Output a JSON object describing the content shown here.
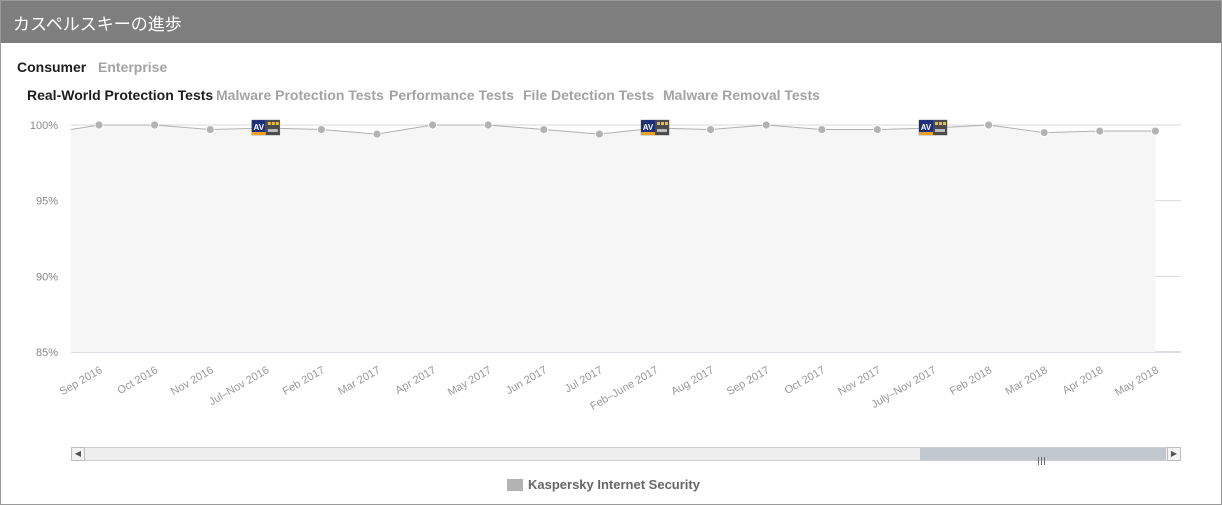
{
  "header": {
    "title": "カスペルスキーの進歩"
  },
  "segments": [
    {
      "label": "Consumer",
      "active": true
    },
    {
      "label": "Enterprise",
      "active": false
    }
  ],
  "tabs": [
    {
      "label": "Real-World Protection Tests",
      "active": true
    },
    {
      "label": "Malware Protection Tests",
      "active": false
    },
    {
      "label": "Performance Tests",
      "active": false
    },
    {
      "label": "File Detection Tests",
      "active": false
    },
    {
      "label": "Malware Removal Tests",
      "active": false
    }
  ],
  "colors": {
    "line": "#b0b0b0",
    "area": "#f6f6f6",
    "grid": "#d9d9d9",
    "header": "#7e7e7e"
  },
  "chart_data": {
    "type": "area",
    "categories": [
      "Sep 2016",
      "Oct 2016",
      "Nov 2016",
      "Jul–Nov 2016",
      "Feb 2017",
      "Mar 2017",
      "Apr 2017",
      "May 2017",
      "Jun 2017",
      "Jul 2017",
      "Feb–June 2017",
      "Aug 2017",
      "Sep 2017",
      "Oct 2017",
      "Nov 2017",
      "July–Nov 2017",
      "Feb 2018",
      "Mar 2018",
      "Apr 2018",
      "May 2018"
    ],
    "series": [
      {
        "name": "Kaspersky Internet Security",
        "values": [
          100,
          100,
          99.7,
          99.8,
          99.7,
          99.4,
          100,
          100,
          99.7,
          99.4,
          99.8,
          99.7,
          100,
          99.7,
          99.7,
          99.8,
          100,
          99.5,
          99.6,
          99.6
        ],
        "award_badges": [
          "Jul–Nov 2016",
          "Feb–June 2017",
          "July–Nov 2017"
        ],
        "award_badge_text": "AV"
      }
    ],
    "yticks": [
      "100%",
      "95%",
      "90%",
      "85%"
    ],
    "ytick_values": [
      100,
      95,
      90,
      85
    ],
    "ylim": [
      85,
      100
    ],
    "grid": true,
    "legend": "bottom-center",
    "scrollbar": true
  }
}
